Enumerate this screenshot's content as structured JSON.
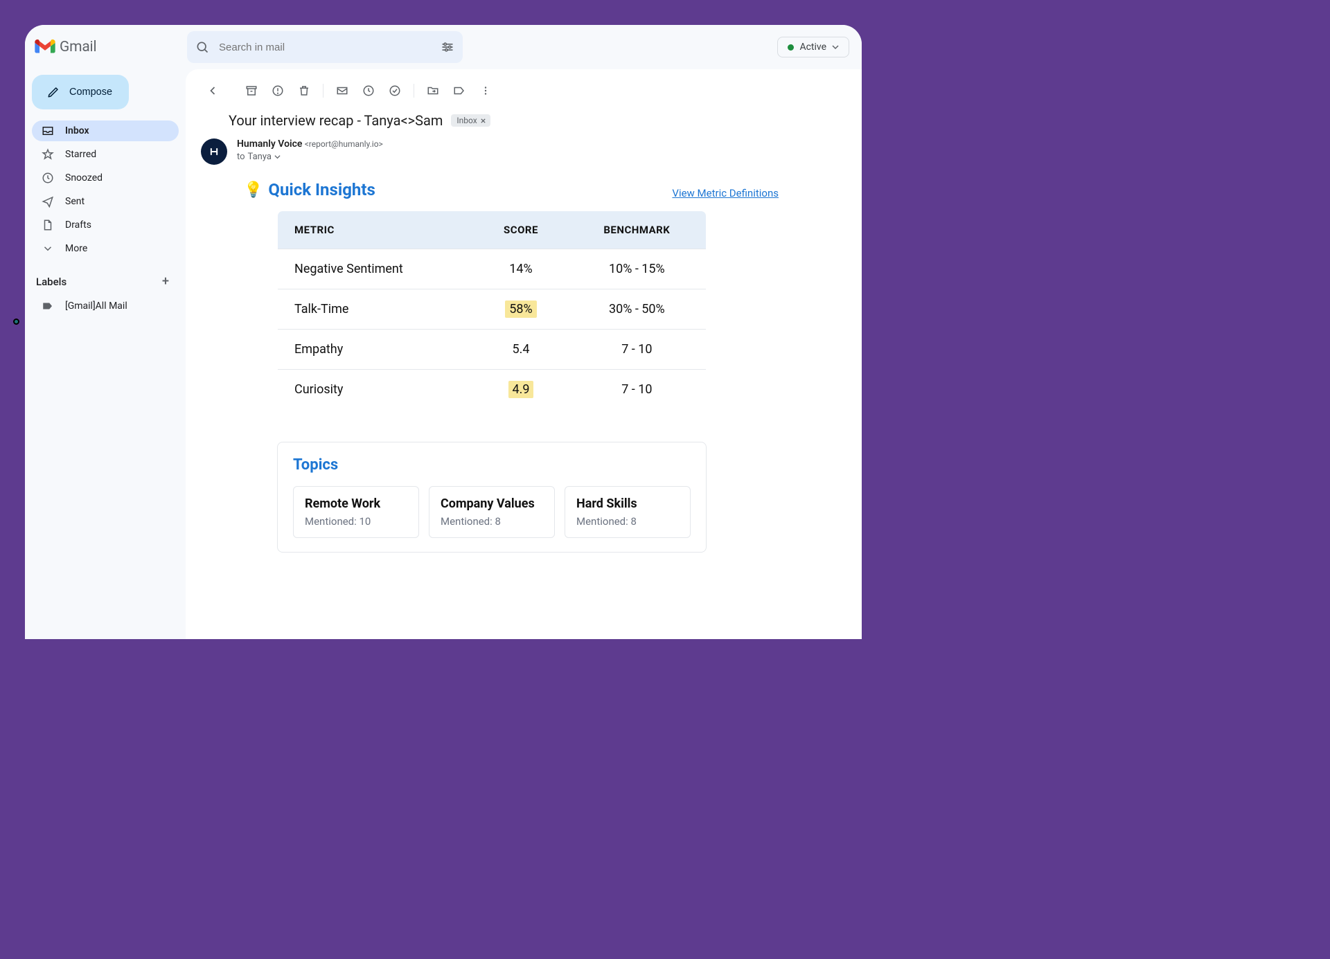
{
  "app": {
    "name": "Gmail"
  },
  "search": {
    "placeholder": "Search in mail"
  },
  "status": {
    "label": "Active"
  },
  "compose": {
    "label": "Compose"
  },
  "nav": {
    "inbox": "Inbox",
    "starred": "Starred",
    "snoozed": "Snoozed",
    "sent": "Sent",
    "drafts": "Drafts",
    "more": "More"
  },
  "labels": {
    "header": "Labels",
    "items": [
      {
        "name": "[Gmail]All Mail"
      }
    ]
  },
  "email": {
    "subject": "Your interview recap - Tanya<>Sam",
    "chip": "Inbox",
    "sender_name": "Humanly Voice",
    "sender_email": "<report@humanly.io>",
    "to_prefix": "to",
    "to_name": "Tanya"
  },
  "insights": {
    "title": "Quick Insights",
    "link": "View Metric Definitions",
    "headers": {
      "metric": "METRIC",
      "score": "SCORE",
      "benchmark": "BENCHMARK"
    },
    "rows": [
      {
        "metric": "Negative Sentiment",
        "score": "14%",
        "benchmark": "10% - 15%",
        "highlight": false
      },
      {
        "metric": "Talk-Time",
        "score": "58%",
        "benchmark": "30% - 50%",
        "highlight": true
      },
      {
        "metric": "Empathy",
        "score": "5.4",
        "benchmark": "7 - 10",
        "highlight": false
      },
      {
        "metric": "Curiosity",
        "score": "4.9",
        "benchmark": "7 - 10",
        "highlight": true
      }
    ]
  },
  "topics": {
    "title": "Topics",
    "mentioned_label": "Mentioned:",
    "items": [
      {
        "name": "Remote Work",
        "count": 10
      },
      {
        "name": "Company Values",
        "count": 8
      },
      {
        "name": "Hard Skills",
        "count": 8
      }
    ]
  },
  "chart_data": {
    "type": "table",
    "title": "Quick Insights",
    "columns": [
      "METRIC",
      "SCORE",
      "BENCHMARK"
    ],
    "rows": [
      [
        "Negative Sentiment",
        "14%",
        "10% - 15%"
      ],
      [
        "Talk-Time",
        "58%",
        "30% - 50%"
      ],
      [
        "Empathy",
        "5.4",
        "7 - 10"
      ],
      [
        "Curiosity",
        "4.9",
        "7 - 10"
      ]
    ]
  }
}
